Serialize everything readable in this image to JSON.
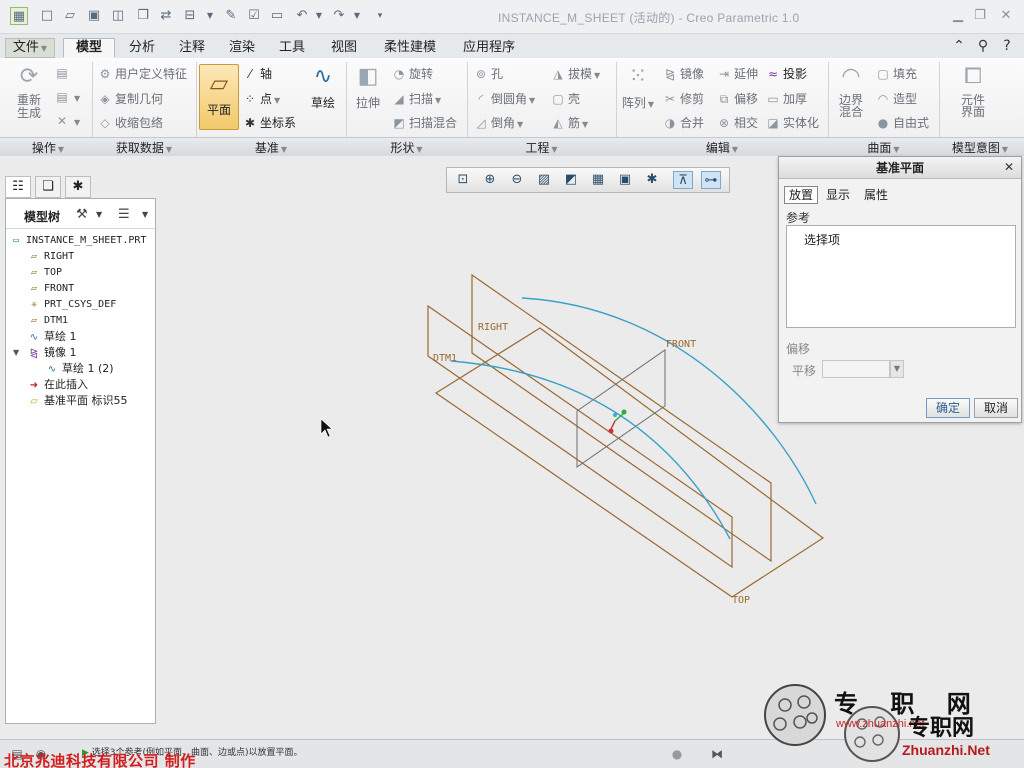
{
  "window": {
    "title": "INSTANCE_M_SHEET (活动的) - Creo Parametric 1.0"
  },
  "tabs": [
    "文件",
    "模型",
    "分析",
    "注释",
    "渲染",
    "工具",
    "视图",
    "柔性建模",
    "应用程序"
  ],
  "active_tab": "模型",
  "ribbon": {
    "operations": {
      "regenerate": "重新生成"
    },
    "get_data": {
      "udf": "用户定义特征",
      "copy_geom": "复制几何",
      "shrinkwrap": "收缩包络"
    },
    "datum": {
      "plane": "平面",
      "axis": "轴",
      "point": "点",
      "csys": "坐标系",
      "sketch": "草绘"
    },
    "shapes": {
      "extrude": "拉伸",
      "revolve": "旋转",
      "sweep": "扫描",
      "swept_blend": "扫描混合"
    },
    "engineering": {
      "hole": "孔",
      "round": "倒圆角",
      "chamfer": "倒角",
      "draft": "拔模",
      "shell": "壳",
      "rib": "筋"
    },
    "editing": {
      "pattern": "阵列",
      "mirror": "镜像",
      "trim": "修剪",
      "merge": "合并",
      "extend": "延伸",
      "offset": "偏移",
      "intersect": "相交",
      "project": "投影",
      "thicken": "加厚",
      "solidify": "实体化"
    },
    "surfaces": {
      "boundary_blend": "边界\n混合",
      "fill": "填充",
      "style": "造型",
      "freestyle": "自由式"
    },
    "model_intent": {
      "component_interface": "元件\n界面"
    },
    "groups": [
      "操作",
      "获取数据",
      "基准",
      "形状",
      "工程",
      "编辑",
      "曲面",
      "模型意图"
    ]
  },
  "model_tree": {
    "label": "模型树",
    "items": [
      {
        "label": "INSTANCE_M_SHEET.PRT",
        "icon": "part-icon",
        "indent": 0
      },
      {
        "label": "RIGHT",
        "icon": "datum-plane-icon",
        "indent": 1
      },
      {
        "label": "TOP",
        "icon": "datum-plane-icon",
        "indent": 1
      },
      {
        "label": "FRONT",
        "icon": "datum-plane-icon",
        "indent": 1
      },
      {
        "label": "PRT_CSYS_DEF",
        "icon": "csys-icon",
        "indent": 1
      },
      {
        "label": "DTM1",
        "icon": "datum-plane-icon",
        "indent": 1
      },
      {
        "label": "草绘 1",
        "icon": "sketch-icon",
        "indent": 1
      },
      {
        "label": "镜像 1",
        "icon": "mirror-icon",
        "indent": 1
      },
      {
        "label": "草绘 1 (2)",
        "icon": "sketch-icon",
        "indent": 2
      },
      {
        "label": "在此插入",
        "icon": "insert-arrow-icon",
        "indent": 1
      },
      {
        "label": "基准平面 标识55",
        "icon": "datum-plane-new-icon",
        "indent": 1
      }
    ]
  },
  "graphics": {
    "datum_labels": [
      "RIGHT",
      "DTM1",
      "FRONT",
      "TOP"
    ]
  },
  "dialog": {
    "title": "基准平面",
    "tabs": [
      "放置",
      "显示",
      "属性"
    ],
    "active_tab": "放置",
    "references_label": "参考",
    "references_item": "选择项",
    "offset_label": "偏移",
    "translation_label": "平移",
    "translation_value": "",
    "ok": "确定",
    "cancel": "取消"
  },
  "status": {
    "message": "选择3个参考(例如平面、曲面、边或点)以放置平面。",
    "credit": "北京兆迪科技有限公司  制作"
  },
  "watermark": {
    "text1": "专 职 网",
    "text2": "专职网",
    "url": "Zhuanzhi.Net",
    "url_small": "www.zhuanzhi.net"
  },
  "colors": {
    "datum_plane": "#9b6a2f",
    "curve": "#3aa0c8",
    "accent": "#2c5e8f",
    "credit_red": "#d41d1d"
  }
}
